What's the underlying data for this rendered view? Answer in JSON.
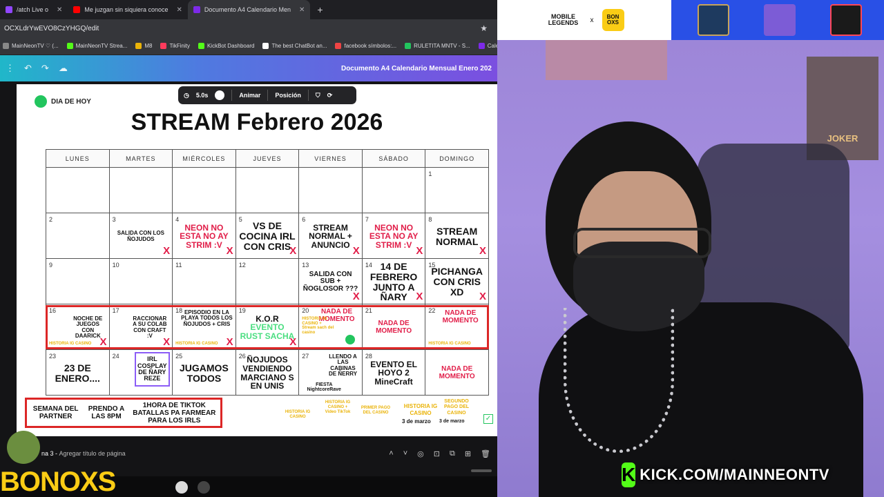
{
  "browser": {
    "tabs": [
      {
        "label": "/atch Live o",
        "color": "#9146ff"
      },
      {
        "label": "Me juzgan sin siquiera conoce",
        "color": "#ff0000"
      },
      {
        "label": "Documento A4 Calendario Men",
        "color": "#7d2ae8",
        "active": true
      }
    ],
    "new_tab": "+",
    "url": "OCXLdrYwEVO8CzYHGQ/edit",
    "bookmarks": [
      {
        "label": "MainNeonTV ♡ (...",
        "color": "#888888"
      },
      {
        "label": "MainNeonTV Strea...",
        "color": "#53fc18"
      },
      {
        "label": "M8",
        "color": "#eab308"
      },
      {
        "label": "TikFinity",
        "color": "#ff3b5c"
      },
      {
        "label": "KickBot Dashboard",
        "color": "#53fc18"
      },
      {
        "label": "The best ChatBot an...",
        "color": "#ffffff"
      },
      {
        "label": "facebook símbolos:...",
        "color": "#ef4444"
      },
      {
        "label": "RULETITA MNTV - S...",
        "color": "#22c55e"
      },
      {
        "label": "Calend",
        "color": "#7d2ae8"
      }
    ]
  },
  "canva": {
    "doc_title": "Documento A4 Calendario Mensual Enero 202",
    "floatbar": {
      "duration": "5.0s",
      "animate": "Animar",
      "position": "Posición"
    },
    "today_label": "DIA DE HOY",
    "title": "STREAM Febrero 2026",
    "days": [
      "LUNES",
      "MARTES",
      "MIÉRCOLES",
      "JUEVES",
      "VIERNES",
      "SÁBADO",
      "DOMINGO"
    ],
    "weeks": [
      [
        {
          "num": "",
          "text": ""
        },
        {
          "num": "",
          "text": ""
        },
        {
          "num": "",
          "text": ""
        },
        {
          "num": "",
          "text": ""
        },
        {
          "num": "",
          "text": ""
        },
        {
          "num": "",
          "text": ""
        },
        {
          "num": "1",
          "text": ""
        }
      ],
      [
        {
          "num": "2",
          "text": ""
        },
        {
          "num": "3",
          "text": "SALIDA CON LOS ÑOJUDOS",
          "x": "X"
        },
        {
          "num": "4",
          "text": "NEON NO ESTA NO AY STRIM :V",
          "x": "X"
        },
        {
          "num": "5",
          "text": "VS DE COCINA IRL CON CRIS",
          "x": "X"
        },
        {
          "num": "6",
          "text": "STREAM NORMAL + ANUNCIO",
          "x": "X"
        },
        {
          "num": "7",
          "text": "NEON NO ESTA NO AY STRIM :V",
          "x": "X"
        },
        {
          "num": "8",
          "text": "STREAM NORMAL",
          "x": "X"
        }
      ],
      [
        {
          "num": "9",
          "text": ""
        },
        {
          "num": "10",
          "text": ""
        },
        {
          "num": "11",
          "text": ""
        },
        {
          "num": "12",
          "text": ""
        },
        {
          "num": "13",
          "text": "SALIDA CON SUB + ÑOGLOSOR ???",
          "x": "X"
        },
        {
          "num": "14",
          "text": "14 DE FEBRERO JUNTO A ÑARY",
          "x": "X"
        },
        {
          "num": "15",
          "text": "PICHANGA CON CRIS XD",
          "x": "X"
        }
      ],
      [
        {
          "num": "16",
          "text": "NOCHE DE JUEGOS CON DAARICK",
          "x": "X",
          "hist": "HISTORIA IG CASINO"
        },
        {
          "num": "17",
          "text": "RACCIONAR A SU COLAB CON CRAFT :V",
          "x": "X"
        },
        {
          "num": "18",
          "text": "EPISODIO EN LA PLAYA TODOS LOS ÑOJUDOS + CRIS",
          "x": "X",
          "hist": "HISTORIA IG CASINO"
        },
        {
          "num": "19",
          "text": "K.O.R",
          "sub": "EVENTO RUST SACHA",
          "x": "X"
        },
        {
          "num": "20",
          "text": "NADA DE MOMENTO",
          "small": "HISTORIA IG CASINO + Stream sach del casino"
        },
        {
          "num": "21",
          "text": "NADA DE MOMENTO"
        },
        {
          "num": "22",
          "text": "NADA DE MOMENTO",
          "hist": "HISTORIA IG CASINO"
        }
      ],
      [
        {
          "num": "23",
          "text": "23 DE ENERO...."
        },
        {
          "num": "24",
          "text": "IRL COSPLAY DE ÑARY REZE"
        },
        {
          "num": "25",
          "text": "JUGAMOS TODOS"
        },
        {
          "num": "26",
          "text": "ÑOJUDOS VENDIENDO MARCIANO S EN UNIS"
        },
        {
          "num": "27",
          "text": "LLENDO A LAS CABINAS DE ÑERRY",
          "extra": "FIESTA NightcoreRave"
        },
        {
          "num": "28",
          "text": "EVENTO EL HOYO 2 MineCraft"
        },
        {
          "num": "",
          "text": "NADA DE MOMENTO"
        }
      ]
    ],
    "bottom_box": [
      "SEMANA DEL PARTNER",
      "PRENDO A LAS 8PM",
      "1HORA DE TIKTOK BATALLAS PA FARMEAR PARA LOS IRLS"
    ],
    "bottom_notes": [
      "HISTORIA IG CASINO",
      "HISTORIA IG CASINO + Video TikTok",
      "PRIMER PAGO DEL CASINO",
      "HISTORIA IG CASINO",
      "SEGUNDO PAGO DEL CASINO"
    ],
    "dates": [
      "3 de marzo",
      "3 de marzo"
    ],
    "check": "✓",
    "page_label": "na 3 -",
    "page_title_placeholder": "Agregar título de página"
  },
  "overlay": {
    "bonoxs": "BONOXS",
    "sponsor_left": "MOBILE LEGENDS",
    "sponsor_x": "x",
    "sponsor_right": "BON OXS",
    "poster": "JOKER",
    "kick_url": "KICK.COM/MAINNEONTV",
    "kick_k": "K"
  }
}
